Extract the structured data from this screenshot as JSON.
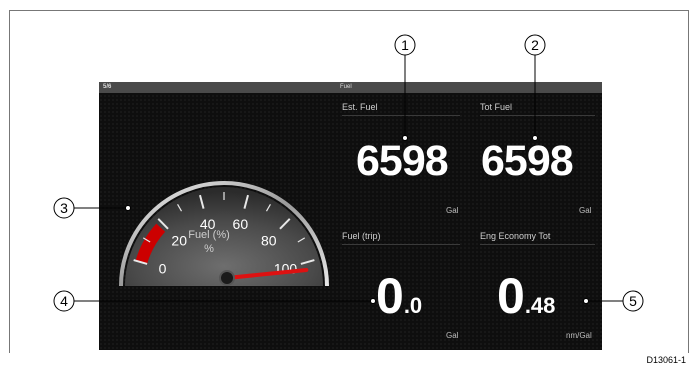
{
  "topbar": {
    "page_indicator": "5/6",
    "title": "Fuel"
  },
  "gauge": {
    "label": "Fuel (%)",
    "unit": "%",
    "tick_labels": [
      "0",
      "20",
      "40",
      "60",
      "80",
      "100"
    ],
    "level_percent": 18,
    "needle_percent": 100,
    "level_color": "#cc0000",
    "needle_color": "#dd1111"
  },
  "cells": {
    "est_fuel": {
      "label": "Est. Fuel",
      "value": "6598",
      "unit": "Gal"
    },
    "tot_fuel": {
      "label": "Tot Fuel",
      "value": "6598",
      "unit": "Gal"
    },
    "fuel_trip": {
      "label": "Fuel (trip)",
      "value_int": "0",
      "value_dec": ".0",
      "unit": "Gal"
    },
    "eng_economy_tot": {
      "label": "Eng Economy Tot",
      "value_int": "0",
      "value_dec": ".48",
      "unit": "nm/Gal"
    }
  },
  "callouts": [
    "1",
    "2",
    "3",
    "4",
    "5"
  ],
  "document_code": "D13061-1"
}
